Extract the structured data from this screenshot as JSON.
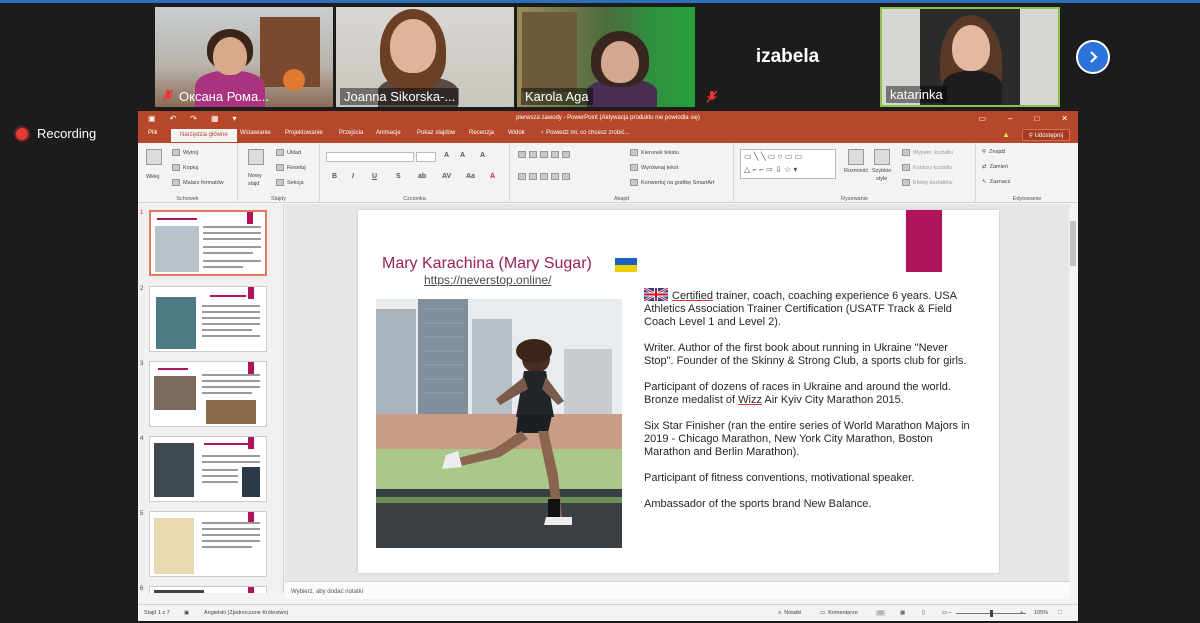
{
  "participants": [
    {
      "name": "Оксана Рома...",
      "muted": true
    },
    {
      "name": "Joanna Sikorska-...",
      "muted": false
    },
    {
      "name": "Karola Aga",
      "muted": false
    },
    {
      "name": "izabela",
      "muted": true
    },
    {
      "name": "katarinka",
      "muted": false
    }
  ],
  "recording": {
    "label": "Recording"
  },
  "ppt": {
    "window_title": "pierwsza zawody - PowerPoint (Aktywacja produktu nie powiodła się)",
    "tabs": [
      "Plik",
      "Narzędzia główne",
      "Wstawianie",
      "Projektowanie",
      "Przejścia",
      "Animacje",
      "Pokaz slajdów",
      "Recenzja",
      "Widok",
      "Powiedz mi, co chcesz zrobić..."
    ],
    "share_label": "Udostępnij",
    "ribbon": {
      "clipboard": {
        "paste": "Wklej",
        "cut": "Wytnij",
        "copy": "Kopiuj",
        "painter": "Malarz formatów",
        "group": "Schowek"
      },
      "slides": {
        "new": "Nowy",
        "new2": "slajd",
        "layout": "Układ",
        "reset": "Resetuj",
        "section": "Sekcja",
        "group": "Slajdy"
      },
      "font": {
        "group": "Czcionka"
      },
      "paragraph": {
        "direction": "Kierunek tekstu",
        "align": "Wyrównaj tekst",
        "smartart": "Konwertuj na grafikę SmartArt",
        "group": "Akapit"
      },
      "drawing": {
        "arrange": "Rozmieść",
        "quick": "Szybkie",
        "quick2": "style",
        "fill": "Wypełn. kształtu",
        "outline": "Kontury kształtu",
        "effects": "Efekty kształtów",
        "group": "Rysowanie"
      },
      "editing": {
        "find": "Znajdź",
        "replace": "Zamień",
        "select": "Zaznacz",
        "group": "Edytowanie"
      }
    },
    "slide_numbers": [
      "1",
      "2",
      "3",
      "4",
      "5",
      "6"
    ],
    "slide": {
      "title": "Mary Karachina (Mary Sugar)",
      "link": "https://neverstop.online/",
      "p1_u": "Certified",
      "p1_rest": " trainer, coach, coaching experience 6 years. USA Athletics Association Trainer Certification (USATF Track & Field Coach Level 1 and Level 2).",
      "p2": "Writer. Author of the first book about running in Ukraine \"Never Stop\". Founder of the Skinny & Strong Club, a sports club for girls.",
      "p3_a": "Participant of dozens of races in Ukraine and around the world. Bronze medalist of ",
      "p3_u": "Wizz",
      "p3_b": " Air Kyiv City Marathon 2015.",
      "p4": "Six Star Finisher (ran the entire series of World Marathon Majors in 2019 - Chicago Marathon, New York City Marathon, Boston Marathon and Berlin Marathon).",
      "p5": "Participant of fitness conventions, motivational speaker.",
      "p6": "Ambassador of the sports brand New Balance."
    },
    "notes_placeholder": "Wybierz, aby dodać notatki",
    "status": {
      "slide": "Slajd 1 z 7",
      "lang": "Angielski (Zjednoczone Królestwo)",
      "notes": "Notatki",
      "comments": "Komentarze",
      "zoom": "105%"
    },
    "colors": {
      "accent": "#b7472a",
      "slide_accent": "#b0145a"
    }
  }
}
